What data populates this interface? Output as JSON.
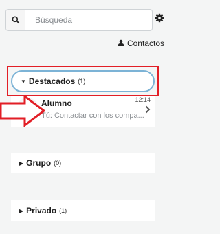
{
  "search": {
    "placeholder": "Búsqueda"
  },
  "header": {
    "contacts_label": "Contactos"
  },
  "sections": [
    {
      "label": "Destacados",
      "count": "(1)",
      "expanded": true
    },
    {
      "label": "Grupo",
      "count": "(0)",
      "expanded": false
    },
    {
      "label": "Privado",
      "count": "(1)",
      "expanded": false
    }
  ],
  "conversation": {
    "name": "Alumno",
    "time": "12:14",
    "preview": "Tú: Contactar con los compa..."
  },
  "icons": [
    "search-icon",
    "gear-icon",
    "user-icon",
    "caret-down-icon",
    "caret-right-icon",
    "chevron-right-icon",
    "arrow-icon"
  ],
  "colors": {
    "highlight": "#e21e26",
    "focus_ring": "#7cb3d6",
    "background": "#f4f5f5"
  }
}
